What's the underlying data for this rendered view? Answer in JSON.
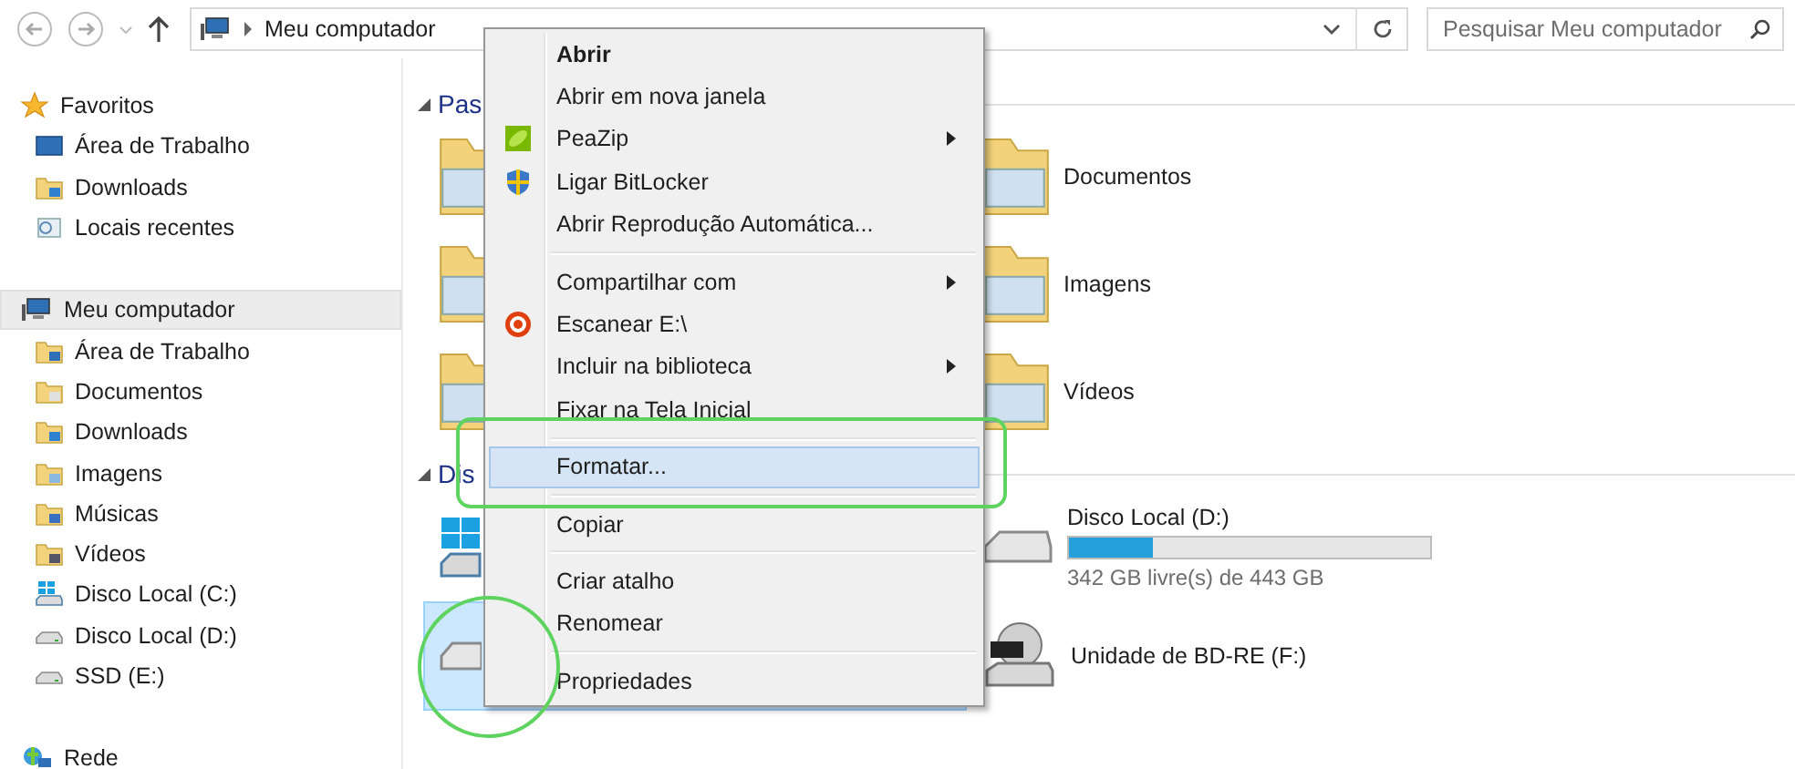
{
  "toolbar": {
    "path": "Meu computador",
    "search": {
      "placeholder": "Pesquisar Meu computador"
    }
  },
  "sidebar": {
    "groups": [
      {
        "label": "Favoritos",
        "kind": "favorites",
        "selected": false,
        "children": [
          {
            "label": "Área de Trabalho",
            "kind": "desktop",
            "selected": false
          },
          {
            "label": "Downloads",
            "kind": "downloads",
            "selected": false
          },
          {
            "label": "Locais recentes",
            "kind": "recent",
            "selected": false
          }
        ]
      },
      {
        "label": "Meu computador",
        "kind": "computer",
        "selected": true,
        "children": [
          {
            "label": "Área de Trabalho",
            "kind": "desktop-folder",
            "selected": false
          },
          {
            "label": "Documentos",
            "kind": "documents",
            "selected": false
          },
          {
            "label": "Downloads",
            "kind": "downloads",
            "selected": false
          },
          {
            "label": "Imagens",
            "kind": "pictures",
            "selected": false
          },
          {
            "label": "Músicas",
            "kind": "music",
            "selected": false
          },
          {
            "label": "Vídeos",
            "kind": "videos",
            "selected": false
          },
          {
            "label": "Disco Local (C:)",
            "kind": "system-drive",
            "selected": false
          },
          {
            "label": "Disco Local (D:)",
            "kind": "drive",
            "selected": false
          },
          {
            "label": "SSD (E:)",
            "kind": "drive",
            "selected": false
          }
        ]
      },
      {
        "label": "Rede",
        "kind": "network",
        "selected": false
      }
    ]
  },
  "main": {
    "sections": [
      {
        "title": "Pas",
        "expanded": true,
        "tiles": [
          {
            "kind": "folder"
          },
          {
            "kind": "folder",
            "label": "Documentos"
          },
          {
            "kind": "folder"
          },
          {
            "kind": "folder",
            "label": "Imagens"
          },
          {
            "kind": "folder"
          },
          {
            "kind": "folder",
            "label": "Vídeos"
          }
        ]
      },
      {
        "title": "Dis",
        "expanded": true,
        "tiles": [
          {
            "kind": "system-drive",
            "selected": false
          },
          {
            "kind": "drive",
            "label": "Disco Local (D:)",
            "level": 0.23,
            "reading": "342 GB livre(s) de 443 GB",
            "selected": false
          },
          {
            "kind": "drive",
            "selected": true
          },
          {
            "kind": "optical-drive",
            "label": "Unidade de BD-RE (F:)",
            "selected": false
          }
        ]
      }
    ]
  },
  "context_menu": {
    "items": [
      {
        "kind": "command",
        "label": "Abrir",
        "default": true,
        "submenu": false,
        "selected": false
      },
      {
        "kind": "command",
        "label": "Abrir em nova janela",
        "default": false,
        "submenu": false,
        "selected": false
      },
      {
        "kind": "command",
        "label": "PeaZip",
        "default": false,
        "submenu": true,
        "selected": false
      },
      {
        "kind": "command",
        "label": "Ligar BitLocker",
        "default": false,
        "submenu": false,
        "selected": false
      },
      {
        "kind": "command",
        "label": "Abrir Reprodução Automática...",
        "default": false,
        "submenu": false,
        "selected": false
      },
      {
        "kind": "separator"
      },
      {
        "kind": "command",
        "label": "Compartilhar com",
        "default": false,
        "submenu": true,
        "selected": false
      },
      {
        "kind": "command",
        "label": "Escanear E:\\",
        "default": false,
        "submenu": false,
        "selected": false
      },
      {
        "kind": "command",
        "label": "Incluir na biblioteca",
        "default": false,
        "submenu": true,
        "selected": false
      },
      {
        "kind": "command",
        "label": "Fixar na Tela Inicial",
        "default": false,
        "submenu": false,
        "selected": false
      },
      {
        "kind": "separator"
      },
      {
        "kind": "command",
        "label": "Formatar...",
        "default": false,
        "submenu": false,
        "selected": true
      },
      {
        "kind": "separator"
      },
      {
        "kind": "command",
        "label": "Copiar",
        "default": false,
        "submenu": false,
        "selected": false
      },
      {
        "kind": "separator"
      },
      {
        "kind": "command",
        "label": "Criar atalho",
        "default": false,
        "submenu": false,
        "selected": false
      },
      {
        "kind": "command",
        "label": "Renomear",
        "default": false,
        "submenu": false,
        "selected": false
      },
      {
        "kind": "separator"
      },
      {
        "kind": "command",
        "label": "Propriedades",
        "default": false,
        "submenu": false,
        "selected": false
      }
    ]
  }
}
